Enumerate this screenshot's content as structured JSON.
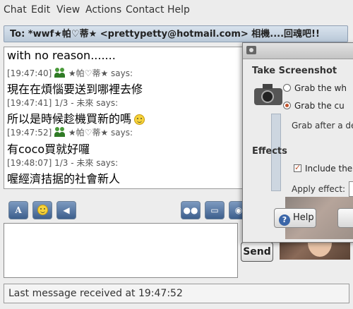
{
  "menu": [
    "Chat",
    "Edit",
    "View",
    "Actions",
    "Contact",
    "Help"
  ],
  "to_bar": "To: *wwf★帕♡蒂★ <prettypetty@hotmail.com> 相機....回魂吧!!",
  "conversation": {
    "lines": [
      {
        "kind": "msg",
        "text": "with no reason......."
      },
      {
        "kind": "hdr",
        "time": "[19:47:40]",
        "sender": "★帕♡蒂★",
        "suffix": "says:"
      },
      {
        "kind": "msg",
        "text": "現在在煩惱要送到哪裡去修"
      },
      {
        "kind": "hdr",
        "time": "[19:47:41]",
        "sender": "1/3 - 未來",
        "suffix": "says:"
      },
      {
        "kind": "msg",
        "text": "所以是時候趁機買新的嗎"
      },
      {
        "kind": "hdr",
        "time": "[19:47:52]",
        "sender": "★帕♡蒂★",
        "suffix": "says:"
      },
      {
        "kind": "msg",
        "text": "有coco買就好囉"
      },
      {
        "kind": "hdr",
        "time": "[19:48:07]",
        "sender": "1/3 - 未來",
        "suffix": "says:"
      },
      {
        "kind": "msg",
        "text": "喔經濟拮据的社會新人"
      }
    ]
  },
  "toolbar": {
    "font_label": "A"
  },
  "send_label": "Send",
  "status_text": "Last message received at 19:47:52",
  "screenshot_dialog": {
    "section_take": "Take Screenshot",
    "option_whole": "Grab the wh",
    "option_current": "Grab the cu",
    "grab_after": "Grab after a de",
    "section_effects": "Effects",
    "include_label": "Include the",
    "apply_effect": "Apply effect:",
    "help_label": "Help"
  }
}
